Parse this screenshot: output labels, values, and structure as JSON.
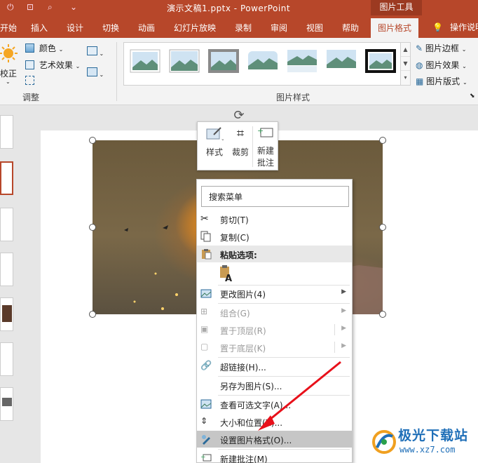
{
  "titlebar": {
    "title": "演示文稿1.pptx  -  PowerPoint",
    "context_tab_group": "图片工具",
    "qat_icons": [
      "power-icon",
      "record-icon",
      "preview-icon",
      "customize-qat-icon"
    ]
  },
  "tabs": {
    "items": [
      "开始",
      "插入",
      "设计",
      "切换",
      "动画",
      "幻灯片放映",
      "录制",
      "审阅",
      "视图",
      "帮助",
      "图片格式"
    ],
    "active": "图片格式",
    "tell_me": "操作说明"
  },
  "ribbon": {
    "adjust": {
      "corrections": "校正",
      "color": "颜色",
      "artistic_effects": "艺术效果",
      "group_label": "调整"
    },
    "styles": {
      "group_label": "图片样式",
      "border": "图片边框",
      "effects": "图片效果",
      "layout": "图片版式"
    }
  },
  "mini_toolbar": {
    "style": "样式",
    "crop": "裁剪",
    "new_comment_line1": "新建",
    "new_comment_line2": "批注"
  },
  "context_menu": {
    "search_placeholder": "搜索菜单",
    "cut": "剪切(T)",
    "copy": "复制(C)",
    "paste_options": "粘贴选项:",
    "change_picture": "更改图片(4)",
    "group": "组合(G)",
    "bring_to_front": "置于顶层(R)",
    "send_to_back": "置于底层(K)",
    "hyperlink": "超链接(H)...",
    "save_as_picture": "另存为图片(S)...",
    "view_alt_text": "查看可选文字(A)...",
    "size_position": "大小和位置(Z)...",
    "format_picture": "设置图片格式(O)...",
    "new_comment": "新建批注(M)"
  },
  "watermark": {
    "name": "极光下载站",
    "url": "www.xz7.com"
  },
  "colors": {
    "accent": "#b7472a",
    "arrow": "#e8101a",
    "highlight": "#c6c6c6"
  }
}
